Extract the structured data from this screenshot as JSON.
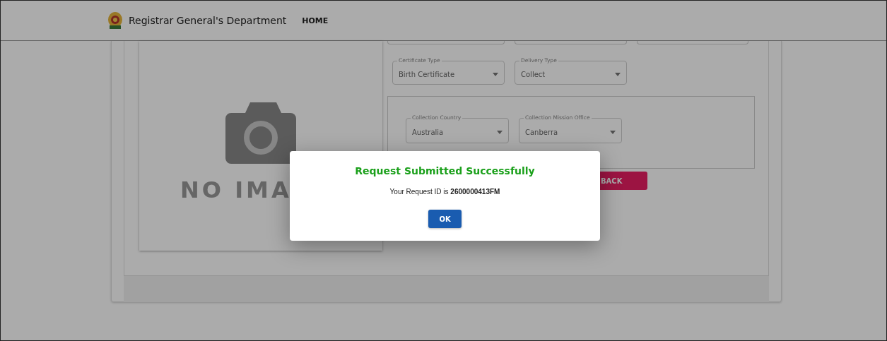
{
  "header": {
    "title": "Registrar General's Department",
    "nav": [
      {
        "label": "HOME"
      }
    ]
  },
  "image_placeholder": {
    "text": "NO IMA"
  },
  "fields": [
    {
      "label": "Certificate Type",
      "value": "Birth Certificate"
    },
    {
      "label": "Delivery Type",
      "value": "Collect"
    }
  ],
  "collection": {
    "fields": [
      {
        "label": "Collection Country",
        "value": "Australia"
      },
      {
        "label": "Collection Mission Office",
        "value": "Canberra"
      }
    ]
  },
  "buttons": [
    {
      "label": "BACK"
    }
  ],
  "dialog": {
    "title": "Request Submitted Successfully",
    "message": "Your Request ID is **2600000413FM**",
    "button": "OK"
  }
}
